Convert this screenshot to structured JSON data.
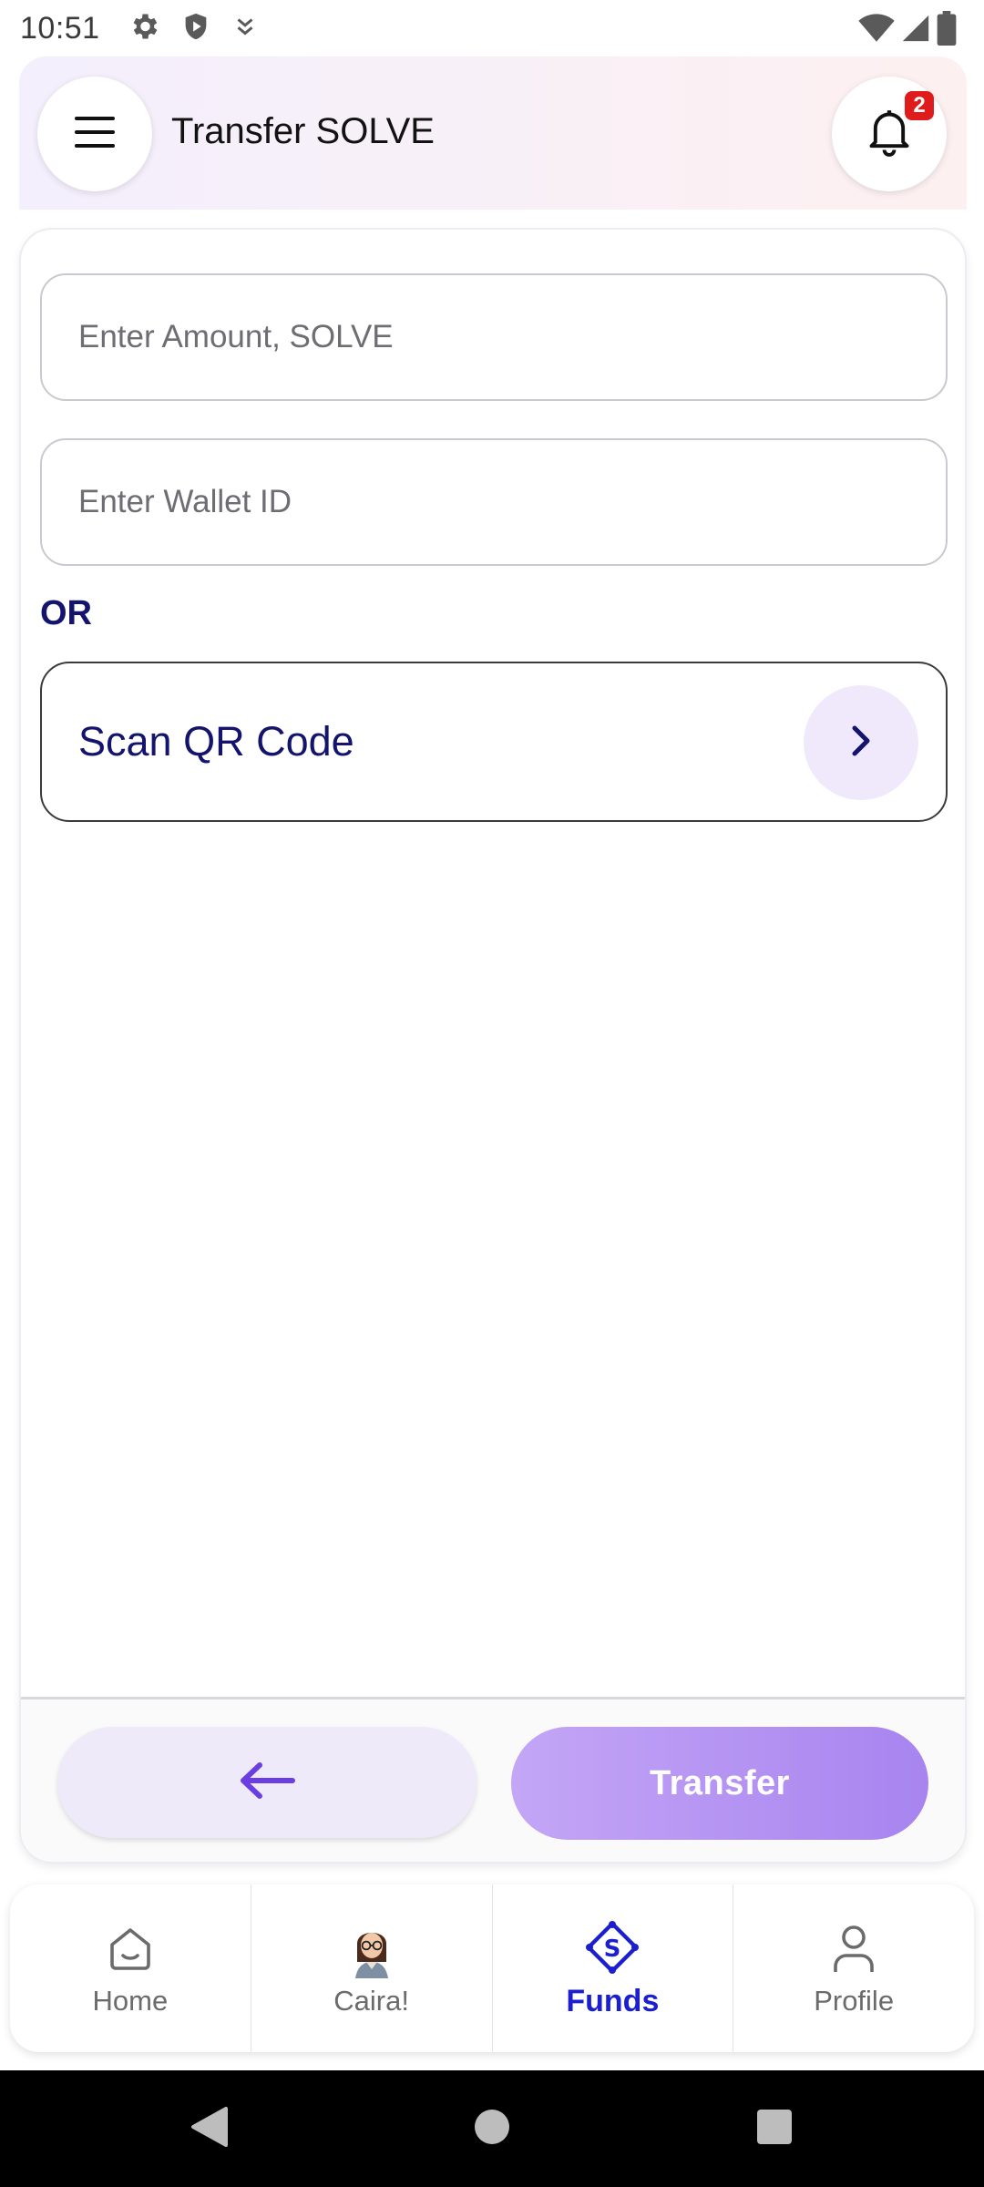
{
  "status_bar": {
    "time": "10:51",
    "icons": [
      "settings-icon",
      "shield-play-icon",
      "location-arrow-icon",
      "wifi-icon",
      "signal-icon",
      "battery-icon"
    ]
  },
  "header": {
    "title": "Transfer SOLVE",
    "notification_count": "2",
    "icons": [
      "menu-icon",
      "bell-icon"
    ]
  },
  "form": {
    "amount_placeholder": "Enter Amount, SOLVE",
    "amount_value": "",
    "wallet_placeholder": "Enter Wallet ID",
    "wallet_value": "",
    "or_label": "OR",
    "scan_label": "Scan QR Code"
  },
  "footer": {
    "transfer_label": "Transfer"
  },
  "bottom_nav": {
    "items": [
      {
        "label": "Home",
        "icon": "home-icon",
        "active": false
      },
      {
        "label": "Caira!",
        "icon": "avatar",
        "active": false
      },
      {
        "label": "Funds",
        "icon": "funds-icon",
        "active": true
      },
      {
        "label": "Profile",
        "icon": "profile-icon",
        "active": false
      }
    ]
  },
  "colors": {
    "brand_navy": "#14146e",
    "active_nav": "#1c1fd0",
    "transfer_gradient_start": "#c4a6f6",
    "transfer_gradient_end": "#a784ef",
    "badge": "#e01b1b"
  }
}
